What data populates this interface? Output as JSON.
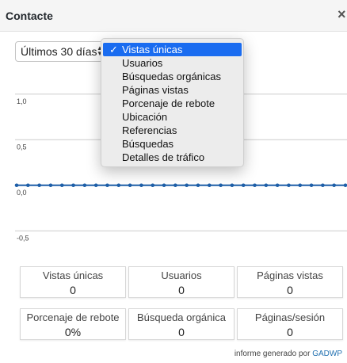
{
  "header": {
    "title": "Contacte",
    "close_label": "×"
  },
  "range_select": {
    "value": "Últimos 30 días",
    "arrow": "▲▼"
  },
  "query_dropdown": {
    "items": [
      {
        "label": "Vistas únicas",
        "selected": true
      },
      {
        "label": "Usuarios",
        "selected": false
      },
      {
        "label": "Búsquedas orgánicas",
        "selected": false
      },
      {
        "label": "Páginas vistas",
        "selected": false
      },
      {
        "label": "Porcenaje de rebote",
        "selected": false
      },
      {
        "label": "Ubicación",
        "selected": false
      },
      {
        "label": "Referencias",
        "selected": false
      },
      {
        "label": "Búsquedas",
        "selected": false
      },
      {
        "label": "Detalles de tráfico",
        "selected": false
      }
    ],
    "check_mark": "✓"
  },
  "chart_data": {
    "type": "line",
    "ylim": [
      -0.75,
      1.25
    ],
    "yticks": [
      "1,0",
      "0,5",
      "0,0",
      "-0,5"
    ],
    "ytick_values": [
      1.0,
      0.5,
      0.0,
      -0.5
    ],
    "series": [
      {
        "values": [
          0,
          0,
          0,
          0,
          0,
          0,
          0,
          0,
          0,
          0,
          0,
          0,
          0,
          0,
          0,
          0,
          0,
          0,
          0,
          0,
          0,
          0,
          0,
          0,
          0,
          0,
          0,
          0,
          0,
          0
        ]
      }
    ],
    "grid": true,
    "color": "#1e5fa8"
  },
  "stats": [
    {
      "label": "Vistas únicas",
      "value": "0"
    },
    {
      "label": "Usuarios",
      "value": "0"
    },
    {
      "label": "Páginas vistas",
      "value": "0"
    },
    {
      "label": "Porcenaje de rebote",
      "value": "0%"
    },
    {
      "label": "Búsqueda orgánica",
      "value": "0"
    },
    {
      "label": "Páginas/sesión",
      "value": "0"
    }
  ],
  "footer": {
    "text": "informe generado por",
    "link": "GADWP"
  }
}
